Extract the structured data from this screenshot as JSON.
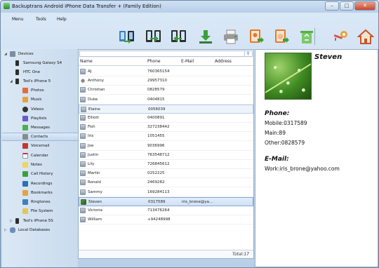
{
  "window": {
    "title": "Backuptrans Android iPhone Data Transfer + (Family Edition)"
  },
  "menu": [
    "Menu",
    "Tools",
    "Help"
  ],
  "toolbar": [
    {
      "name": "transfer-between-devices-icon",
      "color": "#3d7fc1"
    },
    {
      "name": "transfer-android-to-iphone-icon",
      "color": "#2d2d2d"
    },
    {
      "name": "transfer-iphone-to-android-icon",
      "color": "#2d2d2d"
    },
    {
      "name": "download-backup-icon",
      "color": "#3aa13a"
    },
    {
      "name": "print-icon",
      "color": "#8f8f8f"
    },
    {
      "name": "import-contacts-icon",
      "color": "#e07b2c"
    },
    {
      "name": "export-contacts-icon",
      "color": "#e07b2c"
    },
    {
      "name": "recycle-delete-icon",
      "color": "#56b043"
    },
    {
      "name": "register-key-icon",
      "color": "#d9534f"
    },
    {
      "name": "home-icon",
      "color": "#c2572c"
    }
  ],
  "sidebar": {
    "devices_label": "Devices",
    "items": [
      {
        "label": "Samsung Galaxy S4",
        "level": 2,
        "icon": "phone-icon"
      },
      {
        "label": "HTC One",
        "level": 2,
        "icon": "phone-icon"
      },
      {
        "label": "Ted's iPhone 5",
        "level": 2,
        "icon": "iphone-icon"
      },
      {
        "label": "Photos",
        "level": 3,
        "icon": "photos-icon",
        "color": "#e46c3a"
      },
      {
        "label": "Music",
        "level": 3,
        "icon": "music-icon",
        "color": "#e8a23a"
      },
      {
        "label": "Videos",
        "level": 3,
        "icon": "videos-icon",
        "color": "#333333"
      },
      {
        "label": "Playlists",
        "level": 3,
        "icon": "playlists-icon",
        "color": "#6a5acd"
      },
      {
        "label": "Messages",
        "level": 3,
        "icon": "messages-icon",
        "color": "#4caf50"
      },
      {
        "label": "Contacts",
        "level": 3,
        "icon": "contacts-icon",
        "color": "#8a8a8a"
      },
      {
        "label": "Voicemail",
        "level": 3,
        "icon": "voicemail-icon",
        "color": "#c0392b"
      },
      {
        "label": "Calendar",
        "level": 3,
        "icon": "calendar-icon",
        "color": "#e0e0e0"
      },
      {
        "label": "Notes",
        "level": 3,
        "icon": "notes-icon",
        "color": "#f4d35e"
      },
      {
        "label": "Call History",
        "level": 3,
        "icon": "call-history-icon",
        "color": "#3aa13a"
      },
      {
        "label": "Recordings",
        "level": 3,
        "icon": "recordings-icon",
        "color": "#2e6fb5"
      },
      {
        "label": "Bookmarks",
        "level": 3,
        "icon": "bookmarks-icon",
        "color": "#e8a23a"
      },
      {
        "label": "Ringtones",
        "level": 3,
        "icon": "ringtones-icon",
        "color": "#3d7fc1"
      },
      {
        "label": "File System",
        "level": 3,
        "icon": "file-system-icon",
        "color": "#e6c45a"
      },
      {
        "label": "Ted's iPhone 5S",
        "level": 2,
        "icon": "iphone-icon"
      },
      {
        "label": "Local Databases",
        "level": 1,
        "icon": "database-icon"
      }
    ],
    "selected": "Contacts"
  },
  "contacts": {
    "columns": [
      "Name",
      "Phone",
      "E-Mail",
      "Address"
    ],
    "rows": [
      {
        "name": "AJ",
        "phone": "760365154",
        "email": "",
        "avatar": "person"
      },
      {
        "name": "Anthony",
        "phone": "29957310",
        "email": "",
        "avatar": "apple"
      },
      {
        "name": "Christian",
        "phone": "0828579",
        "email": "",
        "avatar": "person"
      },
      {
        "name": "Duke",
        "phone": "0404815",
        "email": "",
        "avatar": "person"
      },
      {
        "name": "Elaine",
        "phone": "0056039",
        "email": "",
        "avatar": "person"
      },
      {
        "name": "Elliott",
        "phone": "0400891",
        "email": "",
        "avatar": "person"
      },
      {
        "name": "Fish",
        "phone": "327238442",
        "email": "",
        "avatar": "person"
      },
      {
        "name": "Iris",
        "phone": "1051455",
        "email": "",
        "avatar": "person"
      },
      {
        "name": "Joe",
        "phone": "9036996",
        "email": "",
        "avatar": "person"
      },
      {
        "name": "Justin",
        "phone": "763548712",
        "email": "",
        "avatar": "person"
      },
      {
        "name": "Lily",
        "phone": "726845612",
        "email": "",
        "avatar": "person"
      },
      {
        "name": "Martin",
        "phone": "0252225",
        "email": "",
        "avatar": "person"
      },
      {
        "name": "Ronald",
        "phone": "2469282",
        "email": "",
        "avatar": "person"
      },
      {
        "name": "Sammy",
        "phone": "169284113",
        "email": "",
        "avatar": "person"
      },
      {
        "name": "Steven",
        "phone": "0317589",
        "email": "iris_brone@ya...",
        "avatar": "leaf"
      },
      {
        "name": "Victoria",
        "phone": "713476264",
        "email": "",
        "avatar": "person"
      },
      {
        "name": "William",
        "phone": "+94248998",
        "email": "",
        "avatar": "person"
      }
    ],
    "hover_row": "Elaine",
    "selected_row": "Steven",
    "total": "Total:17"
  },
  "detail": {
    "name": "Steven",
    "phone_heading": "Phone:",
    "phones": [
      "Mobile:0317589",
      "Main:89",
      "Other:0828579"
    ],
    "email_heading": "E-Mail:",
    "emails": [
      "Work:iris_brone@yahoo.com"
    ]
  }
}
